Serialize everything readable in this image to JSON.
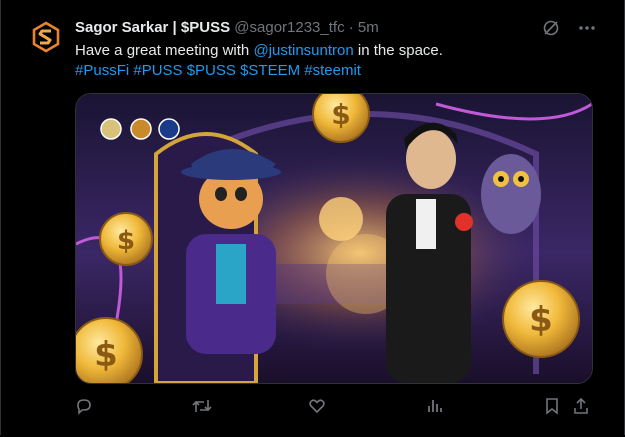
{
  "tweet": {
    "display_name": "Sagor Sarkar | $PUSS",
    "handle": "@sagor1233_tfc",
    "separator": "·",
    "time": "5m",
    "text_part1": "Have a great meeting with ",
    "mention": "@justinsuntron",
    "text_part2": " in the space.",
    "hashtags": "#PussFi #PUSS $PUSS $STEEM #steemit"
  },
  "colors": {
    "background": "#000000",
    "text": "#e7e9ea",
    "secondary": "#71767b",
    "link": "#1d9bf0",
    "avatar_logo": "#e8842a"
  },
  "icons": {
    "header": [
      "grok-icon",
      "more-icon"
    ],
    "actions": [
      "reply-icon",
      "retweet-icon",
      "like-icon",
      "views-icon",
      "bookmark-icon",
      "share-icon"
    ]
  }
}
